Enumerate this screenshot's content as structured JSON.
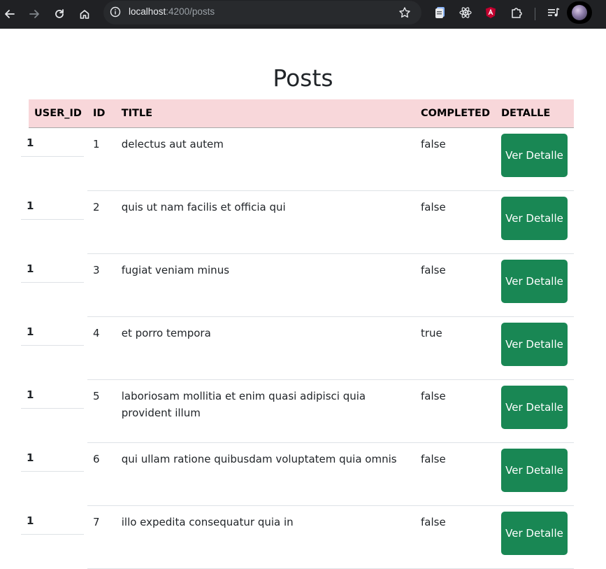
{
  "browser": {
    "url_host": "localhost",
    "url_path": ":4200/posts"
  },
  "page": {
    "title": "Posts"
  },
  "table": {
    "headers": [
      "USER_ID",
      "ID",
      "TITLE",
      "COMPLETED",
      "DETALLE"
    ],
    "rows": [
      {
        "user_id": "1",
        "id": "1",
        "title": "delectus aut autem",
        "completed": "false",
        "button": "Ver Detalle"
      },
      {
        "user_id": "1",
        "id": "2",
        "title": "quis ut nam facilis et officia qui",
        "completed": "false",
        "button": "Ver Detalle"
      },
      {
        "user_id": "1",
        "id": "3",
        "title": "fugiat veniam minus",
        "completed": "false",
        "button": "Ver Detalle"
      },
      {
        "user_id": "1",
        "id": "4",
        "title": "et porro tempora",
        "completed": "true",
        "button": "Ver Detalle"
      },
      {
        "user_id": "1",
        "id": "5",
        "title": "laboriosam mollitia et enim quasi adipisci quia provident illum",
        "completed": "false",
        "button": "Ver Detalle"
      },
      {
        "user_id": "1",
        "id": "6",
        "title": "qui ullam ratione quibusdam voluptatem quia omnis",
        "completed": "false",
        "button": "Ver Detalle"
      },
      {
        "user_id": "1",
        "id": "7",
        "title": "illo expedita consequatur quia in",
        "completed": "false",
        "button": "Ver Detalle"
      }
    ]
  },
  "colors": {
    "header_bg": "#f8d7da",
    "button_bg": "#198754",
    "chrome_bg": "#202124"
  },
  "icons": [
    "back-icon",
    "forward-icon",
    "reload-icon",
    "home-icon",
    "site-info-icon",
    "bookmark-star-icon",
    "extension-doc-icon",
    "extension-react-icon",
    "extension-angular-icon",
    "extensions-puzzle-icon",
    "media-queue-icon"
  ]
}
